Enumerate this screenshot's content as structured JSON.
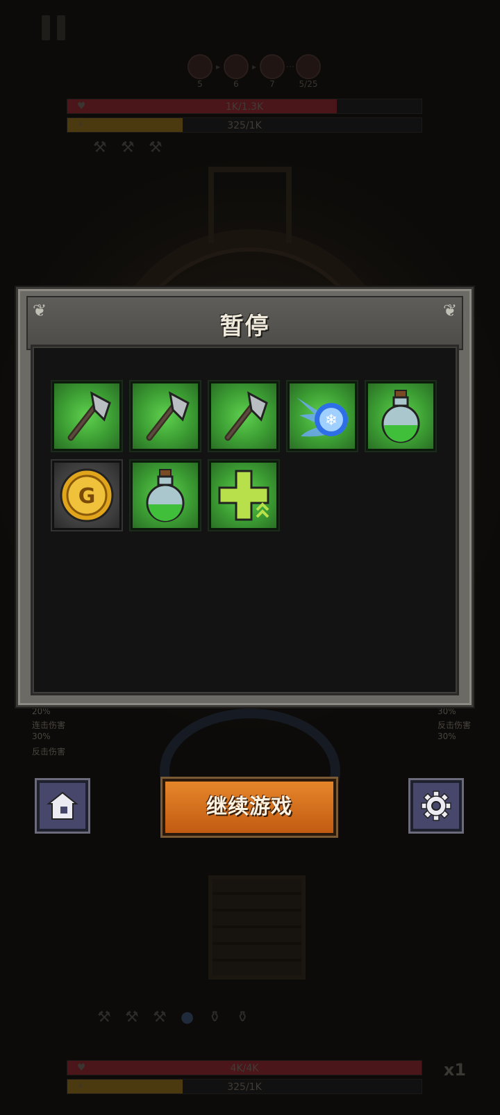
{
  "top": {
    "wave_numbers": [
      "5",
      "6",
      "7",
      "5/25"
    ],
    "enemy_health": "1K/1.3K",
    "enemy_health_fraction": 0.76,
    "enemy_energy": "325/1K",
    "enemy_energy_fraction": 0.325
  },
  "side": {
    "left_percent": "20%",
    "left_combo_label": "连击伤害",
    "left_combo_value": "30%",
    "left_counter_label": "反击伤害",
    "right_percent": "30%",
    "right_counter_label": "反击伤害",
    "right_counter_value": "30%"
  },
  "panel": {
    "title": "暂停",
    "items": [
      {
        "icon": "axe-icon"
      },
      {
        "icon": "axe-icon"
      },
      {
        "icon": "axe-icon"
      },
      {
        "icon": "ice-fireball-icon"
      },
      {
        "icon": "potion-icon"
      },
      {
        "icon": "gold-coin-icon"
      },
      {
        "icon": "potion-icon"
      },
      {
        "icon": "health-plus-upgrade-icon"
      }
    ]
  },
  "buttons": {
    "continue_label": "继续游戏",
    "home_icon": "home-icon",
    "settings_icon": "gear-icon"
  },
  "bottom": {
    "player_health": "4K/4K",
    "player_health_fraction": 1.0,
    "player_energy": "325/1K",
    "player_energy_fraction": 0.325,
    "speed": "x1"
  },
  "colors": {
    "continue_button": "#d8721f",
    "item_green": "#4fb842",
    "panel_gray": "#6b6a65",
    "health_red": "#5a1a1c",
    "energy_yellow": "#5c4712"
  }
}
